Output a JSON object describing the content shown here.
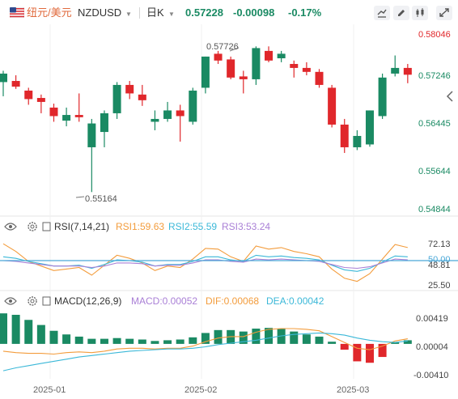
{
  "header": {
    "pair_name": "纽元/美元",
    "symbol": "NZDUSD",
    "interval": "日K",
    "last_price": "0.57228",
    "change": "-0.00098",
    "change_pct": "-0.17%",
    "up_color": "#1a8a63",
    "down_color": "#e0272b",
    "flag_icon": "us-flag-icon"
  },
  "panels": {
    "rsi": {
      "title": "RSI(7,14,21)",
      "rsi1": "RSI1:59.63",
      "rsi2": "RSI2:55.59",
      "rsi3": "RSI3:53.24",
      "rsi1_color": "#f39c3c",
      "rsi2_color": "#3bb8d8",
      "rsi3_color": "#a97fd6",
      "level_color": "#4aa8d8",
      "ticks": [
        "72.13",
        "50.00",
        "48.81",
        "25.50"
      ]
    },
    "macd": {
      "title": "MACD(12,26,9)",
      "macd": "MACD:0.00052",
      "dif": "DIF:0.00068",
      "dea": "DEA:0.00042",
      "macd_color": "#a97fd6",
      "dif_color": "#f39c3c",
      "dea_color": "#3bb8d8",
      "ticks": [
        "0.00419",
        "0.00004",
        "-0.00410"
      ]
    }
  },
  "x_labels": [
    "2025-01",
    "2025-02",
    "2025-03"
  ],
  "chart_data": [
    {
      "type": "candlestick",
      "title": "NZDUSD 日K",
      "y_ticks": [
        "0.58046",
        "0.57246",
        "0.56445",
        "0.55644",
        "0.54844"
      ],
      "ylim": [
        0.5475,
        0.5812
      ],
      "annotations": [
        {
          "text": "0.57726"
        },
        {
          "text": "0.55164"
        }
      ],
      "candles": [
        {
          "o": 0.571,
          "h": 0.573,
          "l": 0.5685,
          "c": 0.5725
        },
        {
          "o": 0.5712,
          "h": 0.5722,
          "l": 0.5698,
          "c": 0.5702
        },
        {
          "o": 0.5695,
          "h": 0.57,
          "l": 0.567,
          "c": 0.568
        },
        {
          "o": 0.5682,
          "h": 0.5688,
          "l": 0.5655,
          "c": 0.5675
        },
        {
          "o": 0.5665,
          "h": 0.5672,
          "l": 0.564,
          "c": 0.565
        },
        {
          "o": 0.5642,
          "h": 0.5665,
          "l": 0.5632,
          "c": 0.5652
        },
        {
          "o": 0.5652,
          "h": 0.569,
          "l": 0.564,
          "c": 0.5648
        },
        {
          "o": 0.5595,
          "h": 0.5645,
          "l": 0.5516,
          "c": 0.5637
        },
        {
          "o": 0.5622,
          "h": 0.566,
          "l": 0.5595,
          "c": 0.5655
        },
        {
          "o": 0.5655,
          "h": 0.571,
          "l": 0.5645,
          "c": 0.5705
        },
        {
          "o": 0.5705,
          "h": 0.5712,
          "l": 0.568,
          "c": 0.569
        },
        {
          "o": 0.5688,
          "h": 0.5705,
          "l": 0.5668,
          "c": 0.5678
        },
        {
          "o": 0.564,
          "h": 0.566,
          "l": 0.5625,
          "c": 0.5645
        },
        {
          "o": 0.5645,
          "h": 0.5675,
          "l": 0.564,
          "c": 0.566
        },
        {
          "o": 0.566,
          "h": 0.567,
          "l": 0.5605,
          "c": 0.565
        },
        {
          "o": 0.564,
          "h": 0.57,
          "l": 0.5635,
          "c": 0.5695
        },
        {
          "o": 0.57,
          "h": 0.5755,
          "l": 0.569,
          "c": 0.5755
        },
        {
          "o": 0.576,
          "h": 0.5765,
          "l": 0.5742,
          "c": 0.5748
        },
        {
          "o": 0.575,
          "h": 0.5755,
          "l": 0.5715,
          "c": 0.5718
        },
        {
          "o": 0.572,
          "h": 0.573,
          "l": 0.569,
          "c": 0.5715
        },
        {
          "o": 0.5715,
          "h": 0.5773,
          "l": 0.5705,
          "c": 0.577
        },
        {
          "o": 0.5765,
          "h": 0.5773,
          "l": 0.5745,
          "c": 0.5748
        },
        {
          "o": 0.5752,
          "h": 0.5765,
          "l": 0.5745,
          "c": 0.576
        },
        {
          "o": 0.5742,
          "h": 0.5748,
          "l": 0.5718,
          "c": 0.5735
        },
        {
          "o": 0.5735,
          "h": 0.5745,
          "l": 0.5722,
          "c": 0.5728
        },
        {
          "o": 0.5728,
          "h": 0.5733,
          "l": 0.57,
          "c": 0.5705
        },
        {
          "o": 0.57,
          "h": 0.5705,
          "l": 0.563,
          "c": 0.5635
        },
        {
          "o": 0.5635,
          "h": 0.5645,
          "l": 0.5585,
          "c": 0.5595
        },
        {
          "o": 0.5595,
          "h": 0.5625,
          "l": 0.559,
          "c": 0.5615
        },
        {
          "o": 0.56,
          "h": 0.566,
          "l": 0.5596,
          "c": 0.566
        },
        {
          "o": 0.565,
          "h": 0.5725,
          "l": 0.5645,
          "c": 0.5718
        },
        {
          "o": 0.5725,
          "h": 0.5757,
          "l": 0.572,
          "c": 0.5735
        },
        {
          "o": 0.5735,
          "h": 0.5742,
          "l": 0.5708,
          "c": 0.5723
        }
      ]
    },
    {
      "type": "line",
      "title": "RSI(7,14,21)",
      "y_ticks": [
        "72.13",
        "50.00",
        "48.81",
        "25.50"
      ],
      "ylim": [
        15,
        90
      ],
      "series": [
        {
          "name": "RSI1",
          "values": [
            75,
            65,
            52,
            46,
            40,
            42,
            44,
            34,
            47,
            60,
            56,
            50,
            40,
            46,
            44,
            55,
            69,
            68,
            58,
            52,
            72,
            68,
            70,
            65,
            62,
            58,
            42,
            30,
            26,
            36,
            55,
            74,
            70
          ]
        },
        {
          "name": "RSI2",
          "values": [
            58,
            56,
            52,
            49,
            46,
            46,
            47,
            43,
            48,
            54,
            53,
            51,
            46,
            48,
            48,
            52,
            58,
            58,
            54,
            52,
            60,
            58,
            59,
            57,
            56,
            54,
            47,
            41,
            39,
            43,
            51,
            59,
            58
          ]
        },
        {
          "name": "RSI3",
          "values": [
            53,
            52,
            50,
            48,
            46,
            46,
            46,
            44,
            46,
            50,
            50,
            49,
            46,
            47,
            47,
            50,
            54,
            54,
            52,
            51,
            55,
            54,
            55,
            54,
            53,
            52,
            48,
            44,
            43,
            45,
            50,
            55,
            54
          ]
        }
      ]
    },
    {
      "type": "bar",
      "title": "MACD(12,26,9)",
      "y_ticks": [
        "0.00419",
        "0.00004",
        "-0.00410"
      ],
      "ylim": [
        -0.0048,
        0.005
      ],
      "series": [
        {
          "name": "MACD",
          "values": [
            0.0042,
            0.004,
            0.0033,
            0.0026,
            0.0018,
            0.0013,
            0.001,
            0.0007,
            0.0007,
            0.0008,
            0.0007,
            0.0006,
            0.0004,
            0.0005,
            0.0006,
            0.0009,
            0.0015,
            0.0019,
            0.0019,
            0.0017,
            0.0021,
            0.0022,
            0.0021,
            0.0017,
            0.0013,
            0.001,
            0.0003,
            -0.0008,
            -0.0024,
            -0.0026,
            -0.0018,
            0.0002,
            0.0005
          ]
        },
        {
          "name": "DIF",
          "values": [
            -0.001,
            -0.0012,
            -0.0013,
            -0.0013,
            -0.0014,
            -0.0012,
            -0.0011,
            -0.0012,
            -0.001,
            -0.0007,
            -0.0006,
            -0.0006,
            -0.0007,
            -0.0006,
            -0.0006,
            -0.0003,
            0.0003,
            0.0008,
            0.001,
            0.001,
            0.0016,
            0.002,
            0.0021,
            0.0021,
            0.002,
            0.0018,
            0.001,
            0.0002,
            -0.0006,
            -0.0008,
            -0.0003,
            0.0004,
            0.0007
          ]
        },
        {
          "name": "DEA",
          "values": [
            -0.0037,
            -0.0033,
            -0.003,
            -0.0027,
            -0.0024,
            -0.0021,
            -0.0018,
            -0.0016,
            -0.0014,
            -0.0012,
            -0.001,
            -0.0009,
            -0.0008,
            -0.0007,
            -0.0007,
            -0.0006,
            -0.0004,
            -0.0001,
            0.0001,
            0.0003,
            0.0005,
            0.0008,
            0.0011,
            0.0013,
            0.0014,
            0.0015,
            0.0014,
            0.0012,
            0.0008,
            0.0005,
            0.0003,
            0.0002,
            0.0004
          ]
        }
      ]
    }
  ]
}
